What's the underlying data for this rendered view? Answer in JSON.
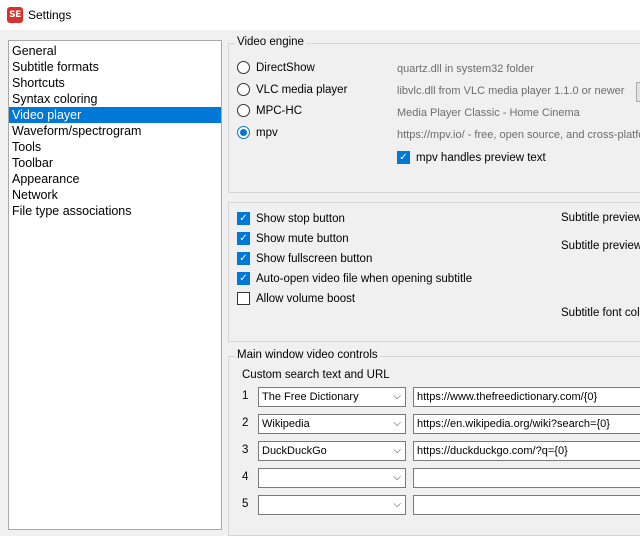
{
  "window": {
    "title": "Settings",
    "icon_text": "SE"
  },
  "nav": {
    "items": [
      {
        "label": "General"
      },
      {
        "label": "Subtitle formats"
      },
      {
        "label": "Shortcuts"
      },
      {
        "label": "Syntax coloring"
      },
      {
        "label": "Video player",
        "selected": true
      },
      {
        "label": "Waveform/spectrogram"
      },
      {
        "label": "Tools"
      },
      {
        "label": "Toolbar"
      },
      {
        "label": "Appearance"
      },
      {
        "label": "Network"
      },
      {
        "label": "File type associations"
      }
    ]
  },
  "video_engine": {
    "title": "Video engine",
    "options": [
      {
        "label": "DirectShow",
        "description": "quartz.dll in system32 folder",
        "checked": false
      },
      {
        "label": "VLC media player",
        "description": "libvlc.dll from VLC media player 1.1.0 or newer",
        "checked": false
      },
      {
        "label": "MPC-HC",
        "description": "Media Player Classic - Home Cinema",
        "checked": false
      },
      {
        "label": "mpv",
        "description": "https://mpv.io/ - free, open source, and cross-platform",
        "checked": true
      }
    ],
    "mpv_preview": {
      "label": "mpv handles preview text",
      "checked": true
    }
  },
  "player_options": {
    "checkboxes": [
      {
        "label": "Show stop button",
        "checked": true
      },
      {
        "label": "Show mute button",
        "checked": true
      },
      {
        "label": "Show fullscreen button",
        "checked": true
      },
      {
        "label": "Auto-open video file when opening subtitle",
        "checked": true
      },
      {
        "label": "Allow volume boost",
        "checked": false
      }
    ],
    "right_labels": [
      "Subtitle preview",
      "Subtitle preview",
      "Subtitle font colo"
    ]
  },
  "main_window": {
    "title": "Main window video controls",
    "custom_search_label": "Custom search text and URL",
    "rows": [
      {
        "num": "1",
        "name": "The Free Dictionary",
        "url": "https://www.thefreedictionary.com/{0}"
      },
      {
        "num": "2",
        "name": "Wikipedia",
        "url": "https://en.wikipedia.org/wiki?search={0}"
      },
      {
        "num": "3",
        "name": "DuckDuckGo",
        "url": "https://duckduckgo.com/?q={0}"
      },
      {
        "num": "4",
        "name": "",
        "url": ""
      },
      {
        "num": "5",
        "name": "",
        "url": ""
      }
    ]
  },
  "colors": {
    "accent": "#0078d7",
    "window_bg": "#f0f0f0",
    "border": "#a8a8a8"
  }
}
